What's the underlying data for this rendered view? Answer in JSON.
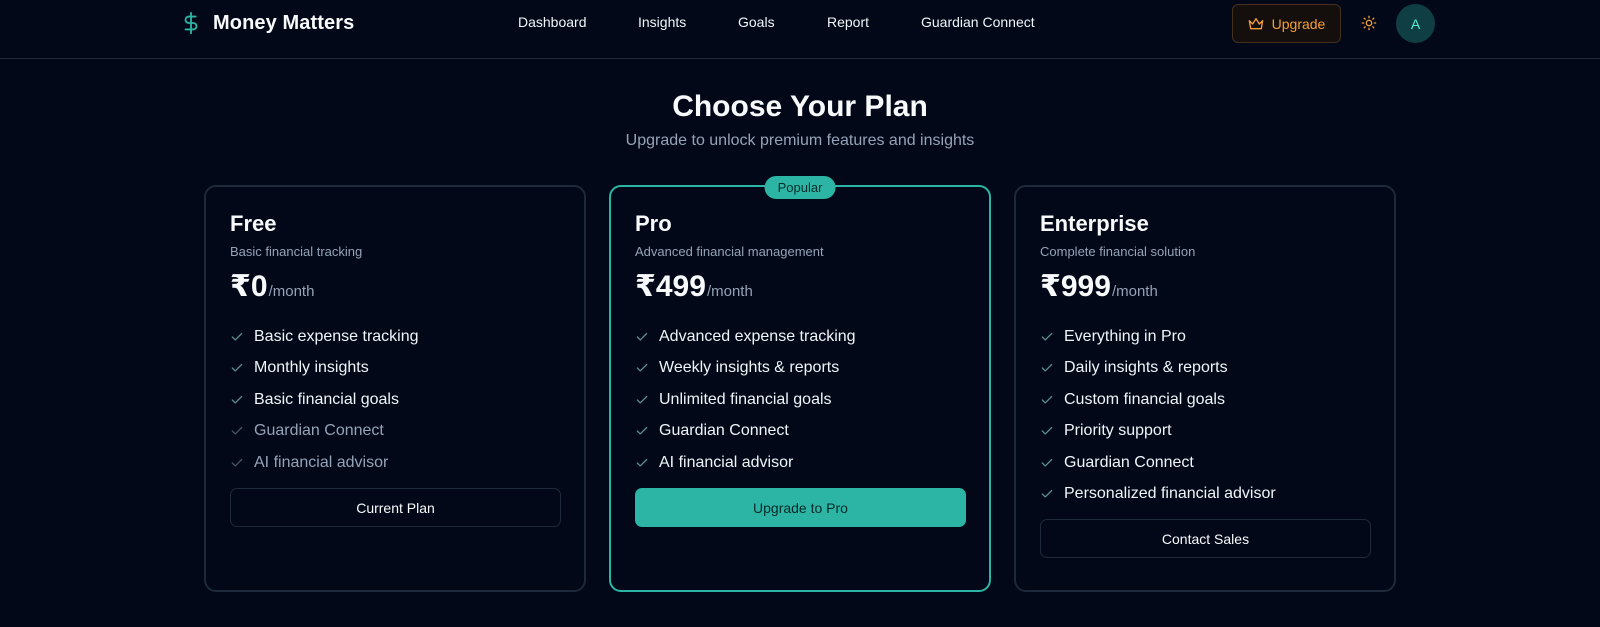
{
  "header": {
    "brand_name": "Money Matters",
    "nav": [
      {
        "label": "Dashboard"
      },
      {
        "label": "Insights"
      },
      {
        "label": "Goals"
      },
      {
        "label": "Report"
      },
      {
        "label": "Guardian Connect"
      }
    ],
    "upgrade_label": "Upgrade",
    "avatar_initial": "A"
  },
  "hero": {
    "title": "Choose Your Plan",
    "subtitle": "Upgrade to unlock premium features and insights"
  },
  "plans": [
    {
      "name": "Free",
      "description": "Basic financial tracking",
      "price": "₹0",
      "period": "/month",
      "features": [
        {
          "label": "Basic expense tracking",
          "included": true
        },
        {
          "label": "Monthly insights",
          "included": true
        },
        {
          "label": "Basic financial goals",
          "included": true
        },
        {
          "label": "Guardian Connect",
          "included": false
        },
        {
          "label": "AI financial advisor",
          "included": false
        }
      ],
      "button_label": "Current Plan"
    },
    {
      "name": "Pro",
      "badge": "Popular",
      "description": "Advanced financial management",
      "price": "₹499",
      "period": "/month",
      "features": [
        {
          "label": "Advanced expense tracking",
          "included": true
        },
        {
          "label": "Weekly insights & reports",
          "included": true
        },
        {
          "label": "Unlimited financial goals",
          "included": true
        },
        {
          "label": "Guardian Connect",
          "included": true
        },
        {
          "label": "AI financial advisor",
          "included": true
        }
      ],
      "button_label": "Upgrade to Pro"
    },
    {
      "name": "Enterprise",
      "description": "Complete financial solution",
      "price": "₹999",
      "period": "/month",
      "features": [
        {
          "label": "Everything in Pro",
          "included": true
        },
        {
          "label": "Daily insights & reports",
          "included": true
        },
        {
          "label": "Custom financial goals",
          "included": true
        },
        {
          "label": "Priority support",
          "included": true
        },
        {
          "label": "Guardian Connect",
          "included": true
        },
        {
          "label": "Personalized financial advisor",
          "included": true
        }
      ],
      "button_label": "Contact Sales"
    }
  ],
  "colors": {
    "background": "#020817",
    "accent": "#2cb5a5",
    "upgrade": "#f59e36",
    "muted_text": "#94a3b8",
    "border": "#1e293b"
  },
  "icons": {
    "brand": "dollar-sign-icon",
    "upgrade": "crown-icon",
    "theme": "sun-icon",
    "feature": "check-icon"
  }
}
